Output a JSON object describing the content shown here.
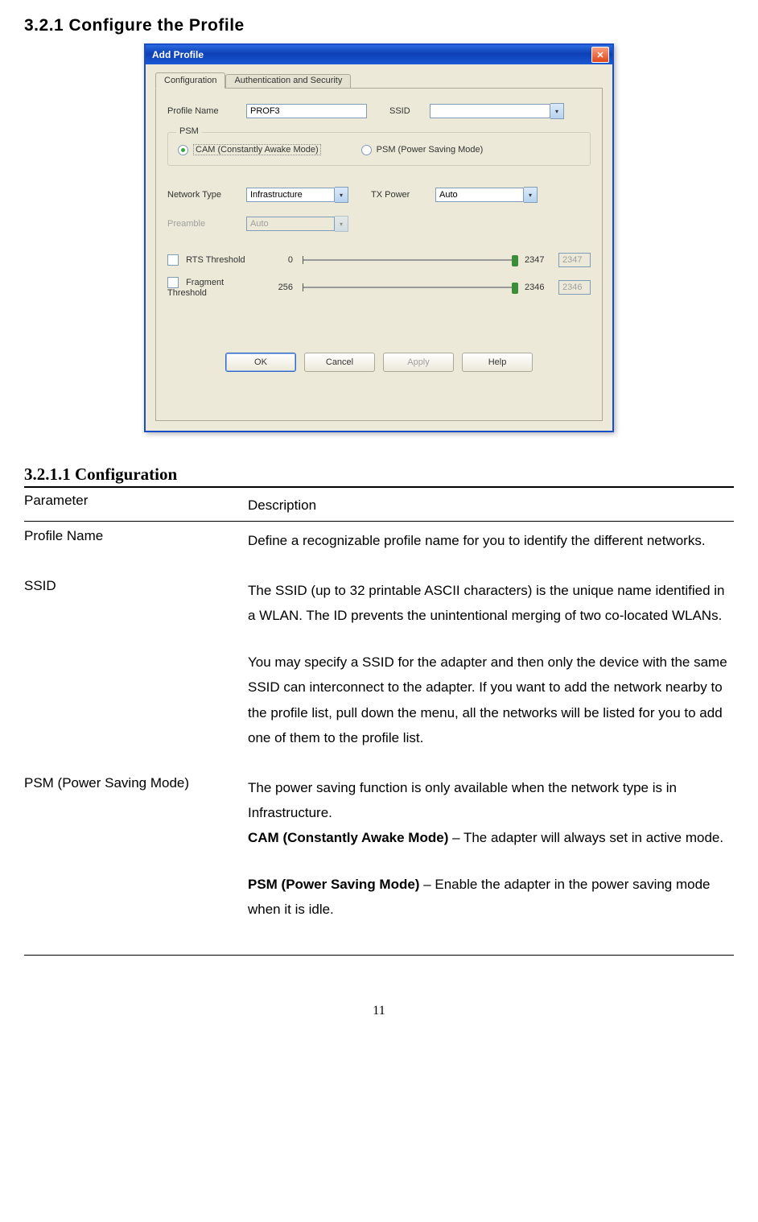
{
  "headings": {
    "section": "3.2.1  Configure the Profile",
    "subsection": "3.2.1.1    Configuration"
  },
  "dialog": {
    "title": "Add Profile",
    "close": "✕",
    "tabs": {
      "config": "Configuration",
      "auth": "Authentication and Security"
    },
    "labels": {
      "profile_name": "Profile Name",
      "ssid": "SSID",
      "psm_group": "PSM",
      "cam_radio": "CAM (Constantly Awake Mode)",
      "psm_radio": "PSM (Power Saving Mode)",
      "network_type": "Network Type",
      "tx_power": "TX Power",
      "preamble": "Preamble",
      "rts": "RTS Threshold",
      "frag": "Fragment Threshold"
    },
    "values": {
      "profile_name": "PROF3",
      "ssid": "",
      "network_type": "Infrastructure",
      "tx_power": "Auto",
      "preamble": "Auto",
      "rts_min": "0",
      "rts_max": "2347",
      "rts_val": "2347",
      "frag_min": "256",
      "frag_max": "2346",
      "frag_val": "2346"
    },
    "buttons": {
      "ok": "OK",
      "cancel": "Cancel",
      "apply": "Apply",
      "help": "Help"
    }
  },
  "table": {
    "header_param": "Parameter",
    "header_desc": "Description",
    "rows": {
      "profile_name": {
        "param": "Profile Name",
        "desc": "Define a recognizable profile name for you to identify the different networks."
      },
      "ssid": {
        "param": "SSID",
        "desc1": "The SSID (up to 32 printable ASCII characters) is the unique name identified in a WLAN. The ID prevents the unintentional merging of two co-located WLANs.",
        "desc2": "You may specify a SSID for the adapter and then only the device with the same SSID can interconnect to the adapter. If you want to add the network nearby to the profile list, pull down the menu, all the networks will be listed for you to add one of them to the profile list."
      },
      "psm": {
        "param": "PSM (Power Saving Mode)",
        "intro": "The power saving function is only available when the network type is in Infrastructure.",
        "cam_bold": "CAM (Constantly Awake Mode)",
        "cam_rest": " – The adapter will always set in active mode.",
        "psm_bold": "PSM (Power Saving Mode)",
        "psm_rest": " – Enable the adapter in the power saving mode when it is idle."
      }
    }
  },
  "page_number": "11"
}
